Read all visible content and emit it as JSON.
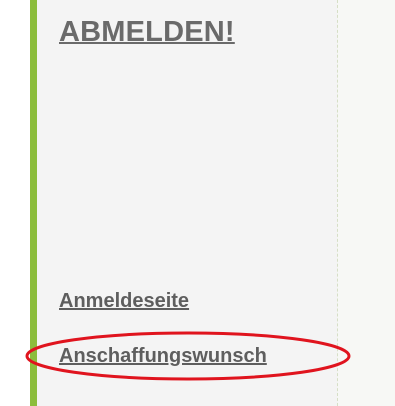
{
  "sidebar": {
    "title_link": "ABMELDEN!",
    "links": [
      {
        "label": "Anmeldeseite"
      },
      {
        "label": "Anschaffungswunsch"
      }
    ]
  },
  "colors": {
    "accent_green": "#8cbd3c",
    "highlight_red": "#e0141e",
    "link_gray": "#5e5e5e"
  }
}
